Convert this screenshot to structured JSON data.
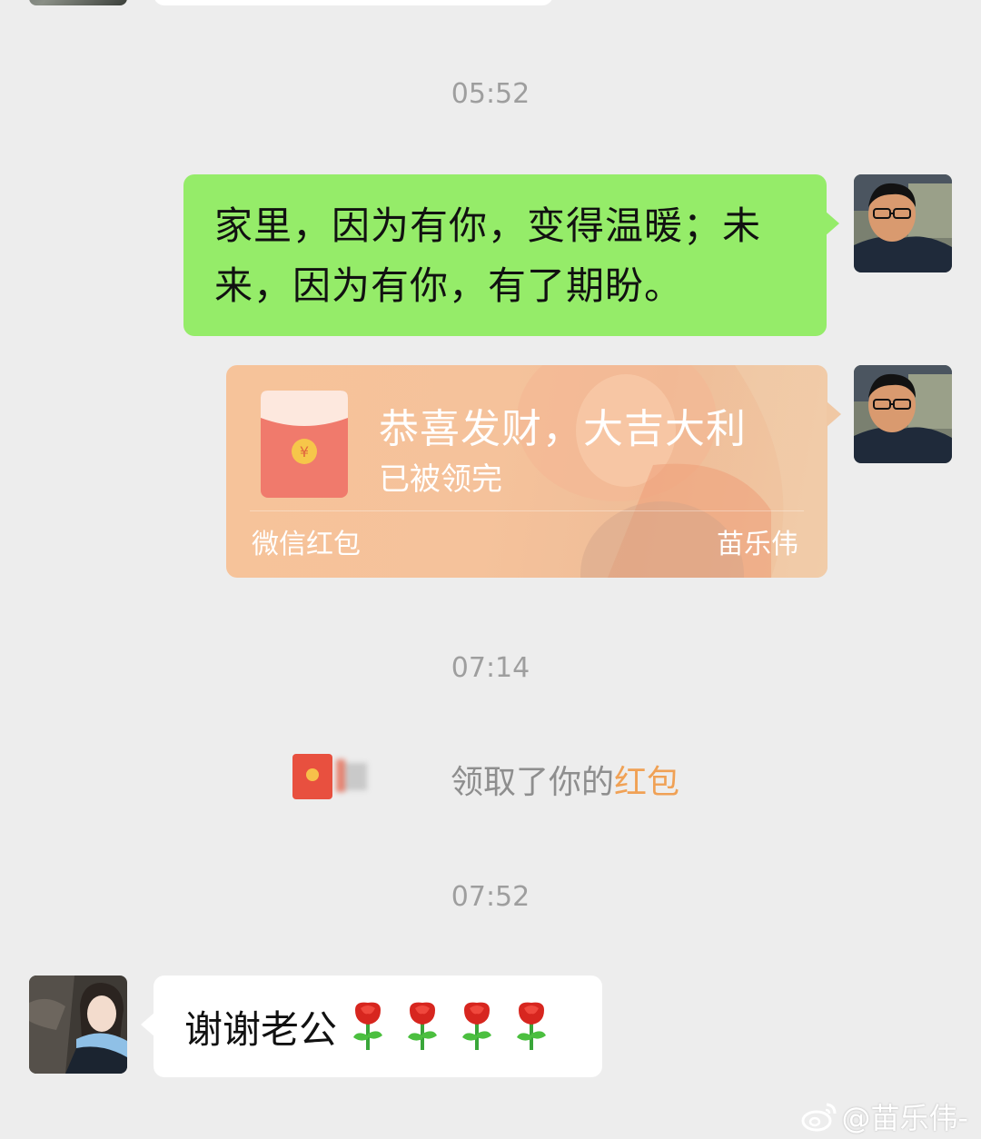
{
  "timestamps": [
    "05:52",
    "07:14",
    "07:52"
  ],
  "messages": {
    "green_text": "家里，因为有你，变得温暖；未来，因为有你，有了期盼。",
    "red_packet": {
      "title": "恭喜发财，大吉大利",
      "status": "已被领完",
      "brand": "微信红包",
      "sender": "苗乐伟",
      "currency_symbol": "¥"
    },
    "system_notice": {
      "text": "领取了你的",
      "highlight": "红包"
    },
    "reply_text": "谢谢老公"
  },
  "watermark": "@苗乐伟-",
  "icons": {
    "red_packet": "red-envelope-icon",
    "rose": "rose-icon",
    "weibo": "weibo-icon"
  },
  "colors": {
    "background": "#ededed",
    "green_bubble": "#95ec69",
    "white_bubble": "#ffffff",
    "timestamp": "#9e9e9e",
    "red_packet_card": "#f6c39a",
    "highlight": "#f0a155"
  }
}
